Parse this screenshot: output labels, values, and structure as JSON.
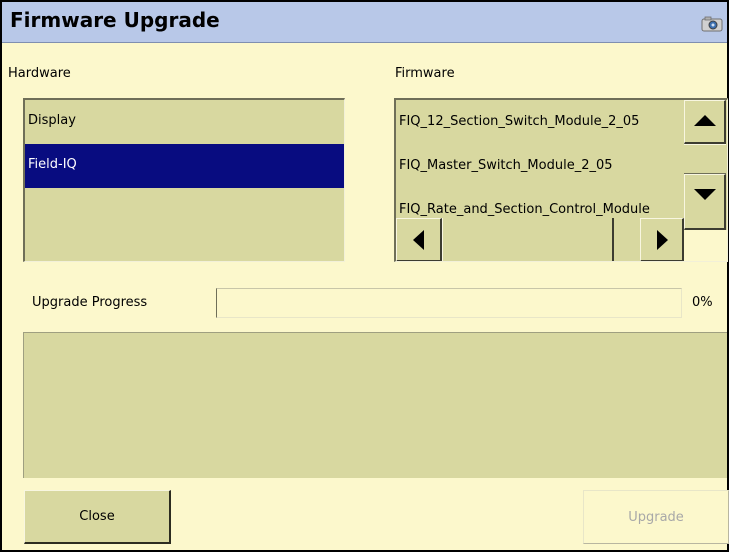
{
  "window": {
    "title": "Firmware Upgrade"
  },
  "hardware": {
    "label": "Hardware",
    "items": [
      "Display",
      "Field-IQ"
    ],
    "selected_index": 1
  },
  "firmware": {
    "label": "Firmware",
    "items": [
      "FIQ_12_Section_Switch_Module_2_05",
      "FIQ_Master_Switch_Module_2_05",
      "FIQ_Rate_and_Section_Control_Module"
    ]
  },
  "progress": {
    "label": "Upgrade Progress",
    "percent_text": "0%",
    "value": 0
  },
  "buttons": {
    "close": "Close",
    "upgrade": "Upgrade"
  },
  "colors": {
    "selection": "#080c80",
    "title_bar": "#b8c8e8",
    "panel": "#fcf8cc",
    "list_bg": "#d8d8a0"
  }
}
